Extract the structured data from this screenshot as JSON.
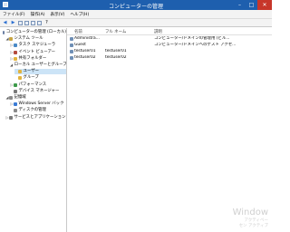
{
  "window": {
    "title": "コンピューターの管理",
    "minimize": "–",
    "maximize": "□",
    "close": "✕"
  },
  "menu": [
    "ファイル(F)",
    "操作(A)",
    "表示(V)",
    "ヘルプ(H)"
  ],
  "toolbar": {
    "buttons": [
      {
        "name": "back-button",
        "glyph": "◀",
        "kind": "arrow"
      },
      {
        "name": "forward-button",
        "glyph": "▶",
        "kind": "arrow"
      },
      {
        "name": "up-folder-button",
        "glyph": "",
        "kind": "box"
      },
      {
        "name": "show-hide-tree-button",
        "glyph": "",
        "kind": "box"
      },
      {
        "name": "export-list-button",
        "glyph": "",
        "kind": "box"
      },
      {
        "name": "properties-button",
        "glyph": "",
        "kind": "box"
      },
      {
        "name": "help-button",
        "glyph": "?",
        "kind": "text"
      }
    ]
  },
  "tree": [
    {
      "name": "tree-computer-management",
      "label": "コンピューターの管理 (ローカル)",
      "indent": 0,
      "exp": "",
      "icon": "#6b7fa3"
    },
    {
      "name": "tree-system-tools",
      "label": "システム ツール",
      "indent": 1,
      "exp": "◢",
      "icon": "#c9a642"
    },
    {
      "name": "tree-task-scheduler",
      "label": "タスク スケジューラ",
      "indent": 2,
      "exp": "▷",
      "icon": "#4a8ac6"
    },
    {
      "name": "tree-event-viewer",
      "label": "イベント ビューアー",
      "indent": 2,
      "exp": "▷",
      "icon": "#b34b3e"
    },
    {
      "name": "tree-shared-folders",
      "label": "共有フォルダー",
      "indent": 2,
      "exp": "▷",
      "icon": "#e2b33c"
    },
    {
      "name": "tree-local-users-groups",
      "label": "ローカル ユーザーとグループ",
      "indent": 2,
      "exp": "◢",
      "icon": "#6f8fb5"
    },
    {
      "name": "tree-users",
      "label": "ユーザー",
      "indent": 3,
      "exp": "",
      "icon": "#e2b33c",
      "selected": true
    },
    {
      "name": "tree-groups",
      "label": "グループ",
      "indent": 3,
      "exp": "",
      "icon": "#e2b33c"
    },
    {
      "name": "tree-performance",
      "label": "パフォーマンス",
      "indent": 2,
      "exp": "▷",
      "icon": "#3d9a4a"
    },
    {
      "name": "tree-device-manager",
      "label": "デバイス マネージャー",
      "indent": 2,
      "exp": "",
      "icon": "#7a7a7a"
    },
    {
      "name": "tree-storage",
      "label": "記憶域",
      "indent": 1,
      "exp": "◢",
      "icon": "#8a8a8a"
    },
    {
      "name": "tree-windows-server-backup",
      "label": "Windows Server バック",
      "indent": 2,
      "exp": "▷",
      "icon": "#3a7bd5"
    },
    {
      "name": "tree-disk-management",
      "label": "ディスクの管理",
      "indent": 2,
      "exp": "",
      "icon": "#8a8a8a"
    },
    {
      "name": "tree-services-applications",
      "label": "サービスとアプリケーション",
      "indent": 1,
      "exp": "▷",
      "icon": "#7a7a7a"
    }
  ],
  "columns": {
    "name": "名前",
    "fullname": "フル ネーム",
    "description": "説明"
  },
  "users": [
    {
      "name": "Administra...",
      "fullname": "",
      "description": "コンピューター/ドメインの管理用 (ビル..."
    },
    {
      "name": "Guest",
      "fullname": "",
      "description": "コンピューター/ドメインへのゲスト アクセ..."
    },
    {
      "name": "testuser01",
      "fullname": "testuser01",
      "description": ""
    },
    {
      "name": "testuser02",
      "fullname": "testuser02",
      "description": ""
    }
  ],
  "watermark": {
    "title": "Window",
    "line1": "アクティベー",
    "line2": "セン アクティブ"
  }
}
